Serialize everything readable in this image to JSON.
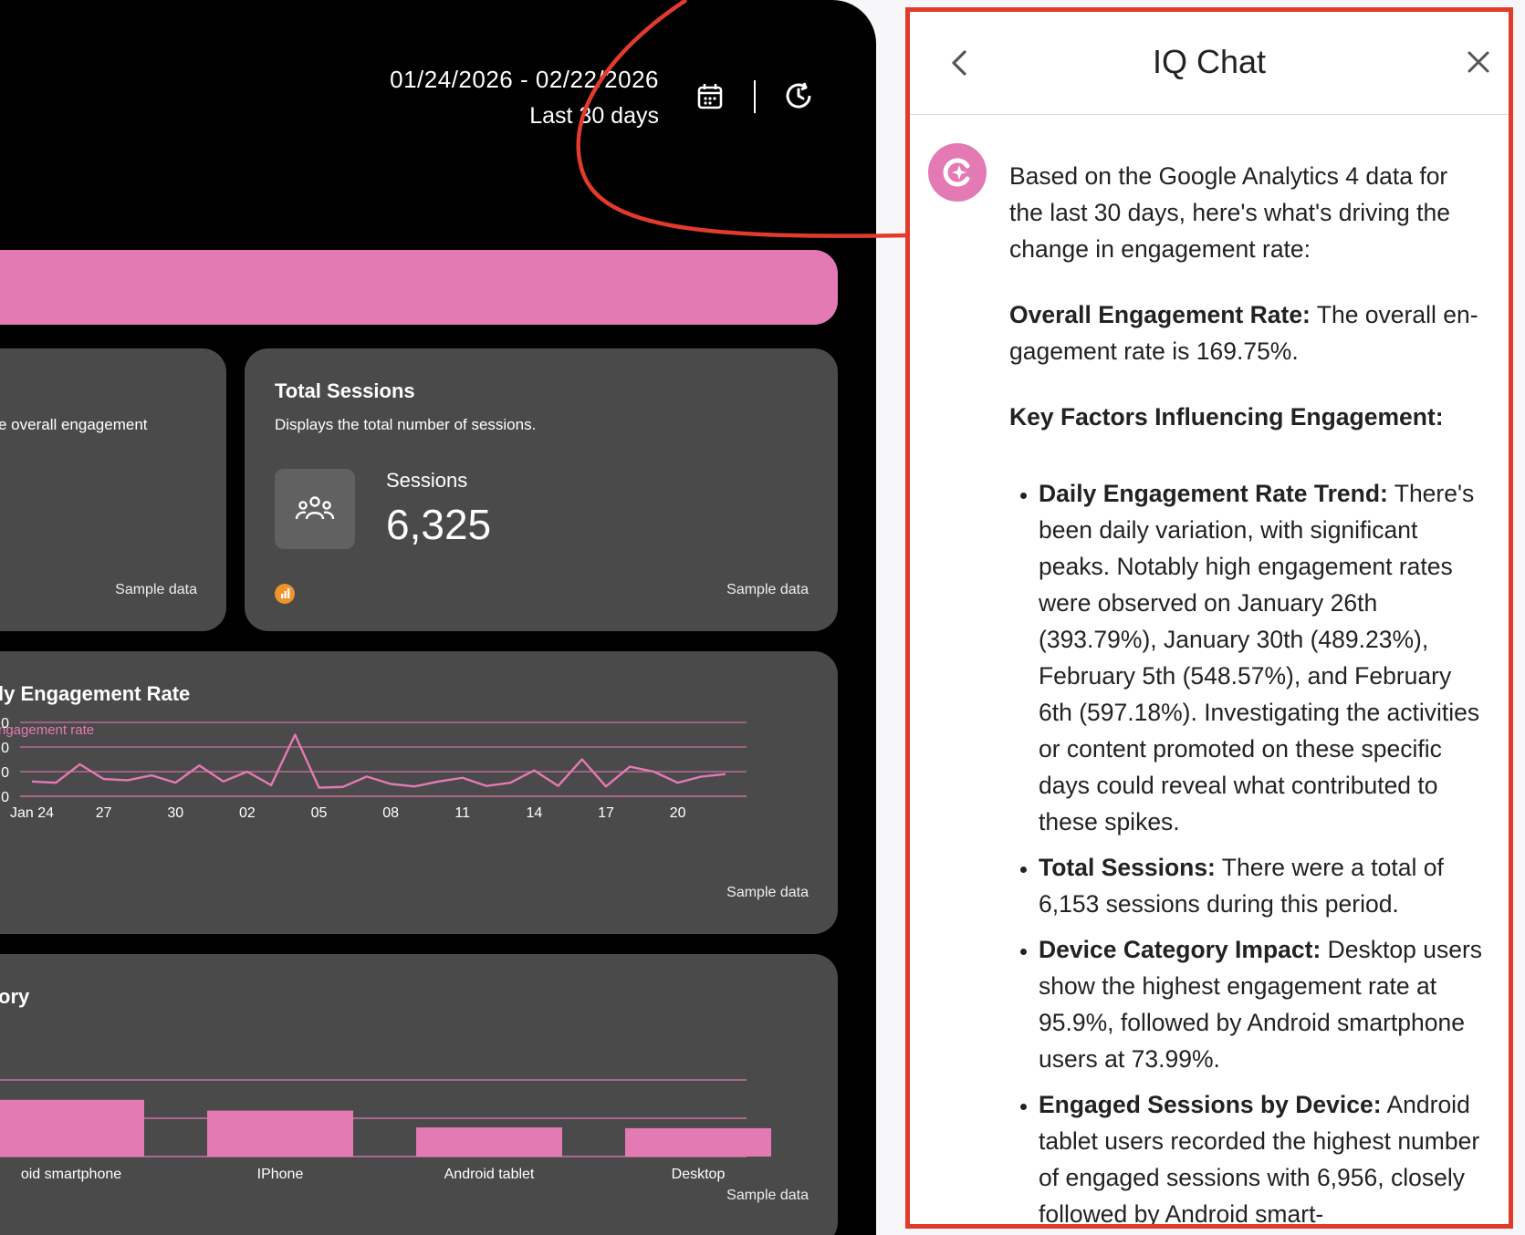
{
  "header": {
    "date_range": "01/24/2026 - 02/22/2026",
    "period": "Last 30 days",
    "calendar_icon": "calendar-icon",
    "refresh_icon": "refresh-clock-icon"
  },
  "cards": {
    "engagement": {
      "desc_fragment": "e overall engagement",
      "sample": "Sample data"
    },
    "sessions": {
      "title": "Total Sessions",
      "desc": "Displays the total number of sessions.",
      "metric_label": "Sessions",
      "metric_value": "6,325",
      "icon": "users-group-icon",
      "source_icon": "google-analytics-icon",
      "sample": "Sample data"
    },
    "daily": {
      "title": "ly Engagement Rate",
      "legend": "ngagement rate",
      "sample": "Sample data"
    },
    "category": {
      "title": "ory",
      "sample": "Sample data"
    }
  },
  "chart_data": [
    {
      "type": "line",
      "title": "Daily Engagement Rate",
      "x_tick_labels": [
        "Jan 24",
        "27",
        "30",
        "02",
        "05",
        "08",
        "11",
        "14",
        "17",
        "20"
      ],
      "y_tick_labels": [
        "0",
        "0",
        "0",
        "0"
      ],
      "series": [
        {
          "name": "Engagement rate",
          "color": "#e37ab4",
          "values": [
            60,
            55,
            130,
            70,
            65,
            85,
            55,
            125,
            60,
            100,
            45,
            250,
            35,
            38,
            80,
            50,
            40,
            60,
            75,
            42,
            55,
            105,
            42,
            150,
            40,
            120,
            100,
            55,
            80,
            90
          ]
        }
      ],
      "ylim": [
        0,
        300
      ],
      "grid": true
    },
    {
      "type": "bar",
      "categories": [
        "oid smartphone",
        "IPhone",
        "Android tablet",
        "Desktop"
      ],
      "values": [
        74,
        60,
        38,
        37
      ],
      "color": "#e37ab4",
      "ylim": [
        0,
        100
      ],
      "grid": true
    }
  ],
  "chat": {
    "title": "IQ Chat",
    "back_icon": "chevron-left-icon",
    "close_icon": "close-icon",
    "avatar_icon": "iq-assistant-icon",
    "intro": "Based on the Google Analytics 4 data for the last 30 days, here's what's driving the change in engagement rate:",
    "overall_label": "Overall Engagement Rate:",
    "overall_text": " The overall en­gagement rate is 169.75%.",
    "factors_heading": "Key Factors Influencing Engagement:",
    "bullets": [
      {
        "label": "Daily Engagement Rate Trend:",
        "text": " There's been daily variation, with significant peaks. Notably high engagement rates were observed on January 26th (393.79%), January 30th (489.23%), February 5th (548.57%), and February 6th (597.18%). Investigating the activi­ties or content promoted on these spe­cific days could reveal what con­tributed to these spikes."
      },
      {
        "label": "Total Sessions:",
        "text": " There were a total of 6,153 sessions during this period."
      },
      {
        "label": "Device Category Impact:",
        "text": " Desktop users show the highest engagement rate at 95.9%, followed by Android smartphone users at 73.99%."
      },
      {
        "label": "Engaged Sessions by Device:",
        "text": " Android tablet users recorded the highest num­ber of engaged sessions with 6,956, closely followed by Android smart-"
      }
    ]
  },
  "annotation": {
    "arrow_color": "#e33b2b",
    "highlight_color": "#e33b2b"
  }
}
